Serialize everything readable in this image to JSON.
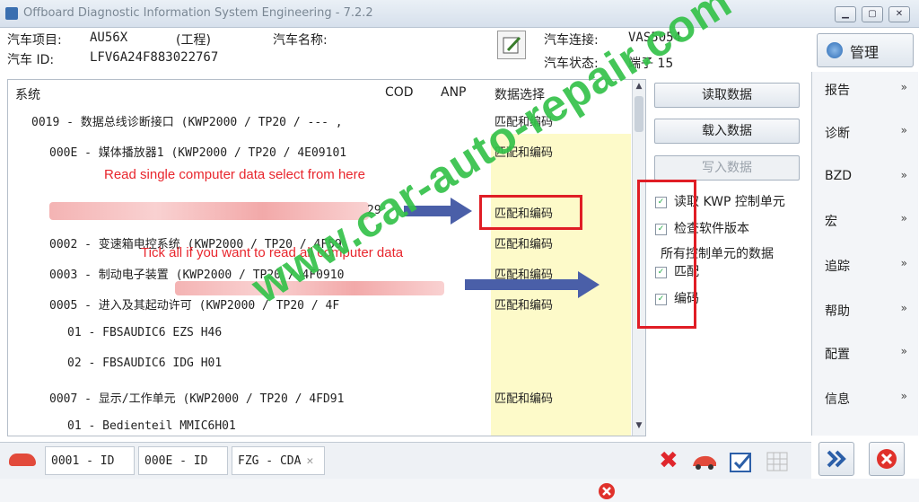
{
  "window": {
    "title": "Offboard Diagnostic Information System Engineering - 7.2.2"
  },
  "header": {
    "project_label": "汽车项目:",
    "project_value": "AU56X",
    "mode_value": "(工程)",
    "name_label": "汽车名称:",
    "id_label": "汽车 ID:",
    "id_value": "LFV6A24F883022767",
    "connection_label": "汽车连接:",
    "connection_value": "VAS5054",
    "status_label": "汽车状态:",
    "status_value": "端子 15",
    "manage_button": "管理"
  },
  "table": {
    "col_system": "系统",
    "col_cod": "COD",
    "col_anp": "ANP",
    "col_data": "数据选择",
    "rows": [
      {
        "text": "0019 - 数据总线诊断接口 (KWP2000 / TP20 / --- ,",
        "data": "匹配和编码"
      },
      {
        "text": "000E - 媒体播放器1 (KWP2000 / TP20 / 4E09101",
        "data": "匹配和编码"
      },
      {
        "text": "29",
        "data": "匹配和编码"
      },
      {
        "text": "0002 - 变速箱电控系统 (KWP2000 / TP20 / 4F59",
        "data": "匹配和编码"
      },
      {
        "text": "0003 - 制动电子装置 (KWP2000 / TP20 / 4F0910",
        "data": "匹配和编码"
      },
      {
        "text": "0005 - 进入及其起动许可 (KWP2000 / TP20 / 4F",
        "data": "匹配和编码"
      },
      {
        "text": "01 - FBSAUDIC6 EZS    H46",
        "data": ""
      },
      {
        "text": "02 - FBSAUDIC6 IDG    H01",
        "data": ""
      },
      {
        "text": "0007 - 显示/工作单元 (KWP2000 / TP20 / 4FD91",
        "data": "匹配和编码"
      },
      {
        "text": "01 - Bedienteil MMIC6H01",
        "data": ""
      }
    ]
  },
  "actions": {
    "read_data": "读取数据",
    "load_data": "载入数据",
    "write_data": "写入数据",
    "chk_read_kwp": "读取 KWP 控制单元",
    "chk_check_sw": "检查软件版本",
    "all_units_label": "所有控制单元的数据",
    "chk_match": "匹配",
    "chk_code": "编码"
  },
  "sidebar": {
    "items": [
      "报告",
      "诊断",
      "BZD",
      "宏",
      "追踪",
      "帮助",
      "配置",
      "信息"
    ]
  },
  "tabs": [
    "0001 - ID",
    "000E - ID",
    "FZG - CDA"
  ],
  "annotations": {
    "read_single": "Read single computer data select from here",
    "tick_all": "Tick all if you want to read all computer data"
  },
  "watermark": "www.car-auto-repair.com",
  "colors": {
    "annotation_red": "#e01d25",
    "highlight_yellow": "#fdfac9",
    "watermark_green": "#35c24a",
    "arrow_blue": "#4a5fa8"
  }
}
